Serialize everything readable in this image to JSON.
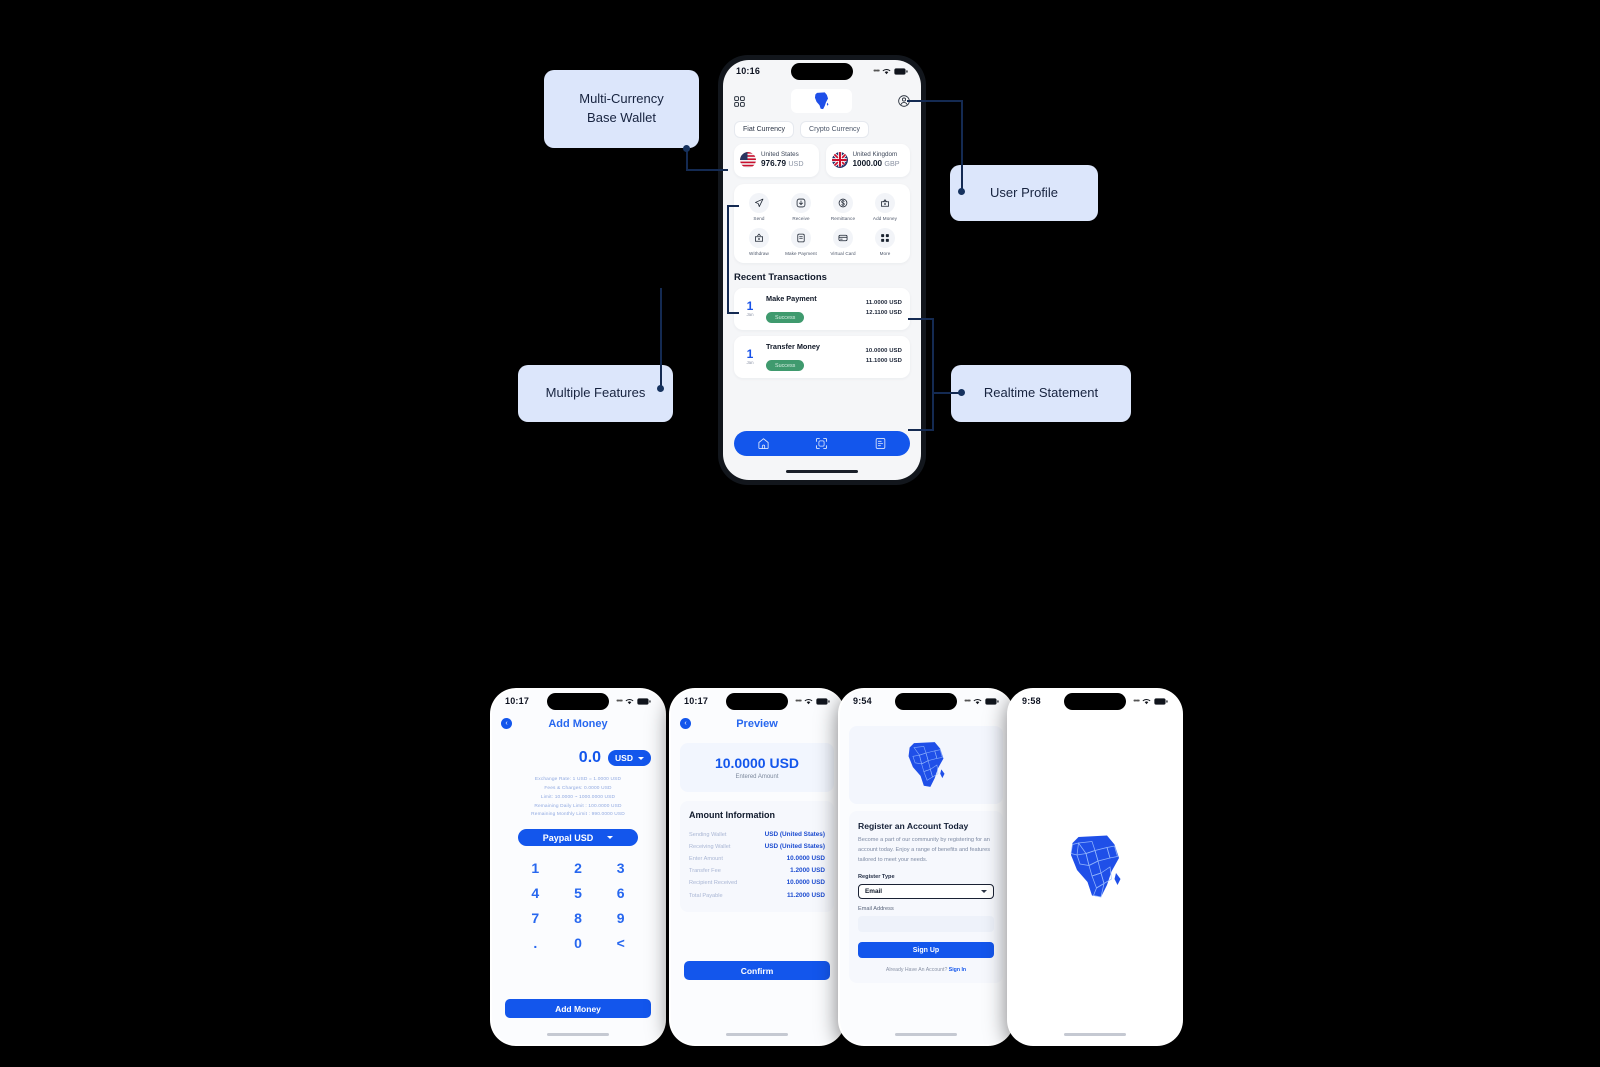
{
  "hero": {
    "status": {
      "time": "10:16",
      "wifi": "wifi-icon",
      "battery": "battery-icon"
    },
    "header": {
      "grid_icon": "grid-menu-icon",
      "logo": "africa-map-logo",
      "profile_icon": "user-profile-icon"
    },
    "tabs": [
      {
        "label": "Fiat Currency",
        "active": true
      },
      {
        "label": "Crypto Currency",
        "active": false
      }
    ],
    "wallets": [
      {
        "country": "United States",
        "amount": "976.79",
        "currency": "USD",
        "flag": "us-flag-icon"
      },
      {
        "country": "United Kingdom",
        "amount": "1000.00",
        "currency": "GBP",
        "flag": "uk-flag-icon"
      }
    ],
    "features": [
      {
        "label": "Send",
        "icon": "send-icon"
      },
      {
        "label": "Receive",
        "icon": "receive-icon"
      },
      {
        "label": "Remittance",
        "icon": "dollar-icon"
      },
      {
        "label": "Add Money",
        "icon": "add-money-icon"
      },
      {
        "label": "Withdraw",
        "icon": "withdraw-icon"
      },
      {
        "label": "Make Payment",
        "icon": "make-payment-icon"
      },
      {
        "label": "Virtual Card",
        "icon": "card-icon"
      },
      {
        "label": "More",
        "icon": "grid-more-icon"
      }
    ],
    "recent_title": "Recent Transactions",
    "transactions": [
      {
        "day": "1",
        "month": "Jan",
        "name": "Make Payment",
        "status": "Success",
        "amount": "11.0000 USD",
        "total": "12.1100 USD"
      },
      {
        "day": "1",
        "month": "Jan",
        "name": "Transfer Money",
        "status": "Success",
        "amount": "10.0000 USD",
        "total": "11.1000 USD"
      }
    ],
    "bottom_nav": [
      {
        "icon": "home-icon"
      },
      {
        "icon": "qr-scan-icon"
      },
      {
        "icon": "statement-icon"
      }
    ]
  },
  "callouts": [
    {
      "id": "multi-currency",
      "text": "Multi-Currency\nBase Wallet",
      "line1": "Multi-Currency",
      "line2": "Base Wallet"
    },
    {
      "id": "user-profile",
      "text": "User Profile",
      "line1": "User Profile",
      "line2": ""
    },
    {
      "id": "multiple-features",
      "text": "Multiple Features",
      "line1": "Multiple Features",
      "line2": ""
    },
    {
      "id": "realtime-statement",
      "text": "Realtime Statement",
      "line1": "Realtime Statement",
      "line2": ""
    }
  ],
  "add_money": {
    "status": {
      "time": "10:17"
    },
    "title": "Add Money",
    "back_icon": "chevron-left-icon",
    "amount": "0.0",
    "currency": "USD",
    "rates": [
      "Exchange Rate: 1 USD = 1.0000 USD",
      "Fees & Charges: 0.0000 USD",
      "Limit: 10.0000 ~ 1000.0000 USD",
      "Remaining Daily Limit  : 100.0000 USD",
      "Remaining Monthly Limit  : 990.0000 USD"
    ],
    "gateway": "Paypal USD",
    "keys": [
      "1",
      "2",
      "3",
      "4",
      "5",
      "6",
      "7",
      "8",
      "9",
      ".",
      "0",
      "<"
    ],
    "cta": "Add Money"
  },
  "preview": {
    "status": {
      "time": "10:17"
    },
    "title": "Preview",
    "back_icon": "chevron-left-icon",
    "amount": "10.0000 USD",
    "amount_label": "Entered Amount",
    "info_title": "Amount Information",
    "rows": [
      {
        "key": "Sending Wallet",
        "value": "USD (United States)"
      },
      {
        "key": "Receiving Wallet",
        "value": "USD (United States)"
      },
      {
        "key": "Enter Amount",
        "value": "10.0000 USD"
      },
      {
        "key": "Transfer Fee",
        "value": "1.2000 USD"
      },
      {
        "key": "Recipient Received",
        "value": "10.0000 USD"
      },
      {
        "key": "Total Payable",
        "value": "11.2000 USD"
      }
    ],
    "cta": "Confirm"
  },
  "register": {
    "status": {
      "time": "9:54"
    },
    "logo": "africa-map-logo",
    "heading": "Register an Account Today",
    "paragraph": "Become a part of our community by registering for an account today. Enjoy a range of benefits and features tailored to meet your needs.",
    "type_label": "Register Type",
    "type_value": "Email",
    "email_label": "Email Address",
    "email_value": "",
    "cta": "Sign Up",
    "footer_text": "Already Have An Account? ",
    "footer_link": "Sign In"
  },
  "splash": {
    "status": {
      "time": "9:58"
    },
    "logo": "africa-map-logo"
  },
  "colors": {
    "brand": "#1356ec",
    "callout_bg": "#dce6fb",
    "success": "#3f9a6e",
    "line": "#142a52"
  }
}
